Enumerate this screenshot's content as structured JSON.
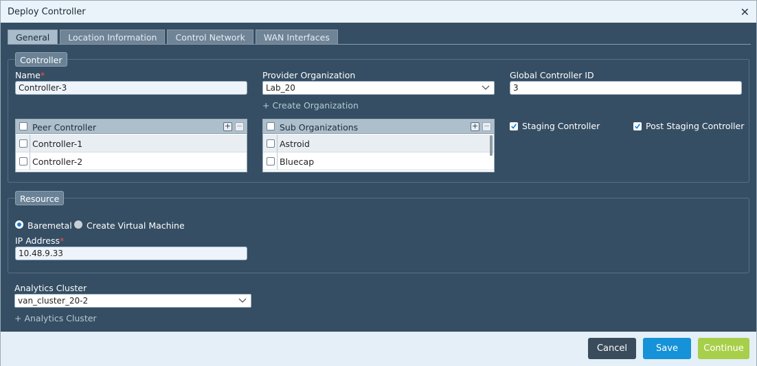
{
  "window": {
    "title": "Deploy Controller"
  },
  "tabs": [
    {
      "label": "General",
      "active": true
    },
    {
      "label": "Location Information",
      "active": false
    },
    {
      "label": "Control Network",
      "active": false
    },
    {
      "label": "WAN Interfaces",
      "active": false
    }
  ],
  "controller": {
    "legend": "Controller",
    "name_label": "Name",
    "required_mark": "*",
    "name_value": "Controller-3",
    "provider_label": "Provider Organization",
    "provider_value": "Lab_20",
    "create_org_link": "+ Create Organization",
    "global_id_label": "Global Controller ID",
    "global_id_value": "3",
    "peer_grid": {
      "header": "Peer Controller",
      "rows": [
        "Controller-1",
        "Controller-2"
      ]
    },
    "suborg_grid": {
      "header": "Sub Organizations",
      "rows": [
        "Astroid",
        "Bluecap"
      ]
    },
    "staging_label": "Staging Controller",
    "staging_checked": true,
    "post_staging_label": "Post Staging Controller",
    "post_staging_checked": true
  },
  "resource": {
    "legend": "Resource",
    "baremetal_label": "Baremetal",
    "create_vm_label": "Create Virtual Machine",
    "ip_label": "IP Address",
    "ip_value": "10.48.9.33"
  },
  "analytics": {
    "label": "Analytics Cluster",
    "value": "van_cluster_20-2",
    "add_link": "+ Analytics Cluster"
  },
  "footer": {
    "cancel": "Cancel",
    "save": "Save",
    "continue": "Continue"
  },
  "colors": {
    "dialog_bg": "#354e63",
    "save": "#1592d8",
    "continue": "#a8cf4a",
    "cancel": "#3a4c5c"
  }
}
